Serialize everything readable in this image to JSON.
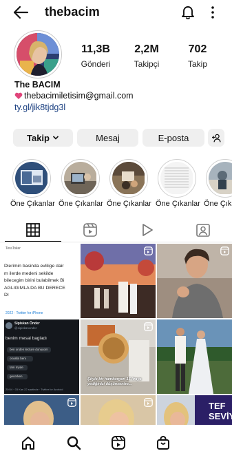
{
  "header": {
    "username": "thebacim"
  },
  "profile": {
    "stats": [
      {
        "value": "11,3B",
        "label": "Gönderi"
      },
      {
        "value": "2,2M",
        "label": "Takipçi"
      },
      {
        "value": "702",
        "label": "Takip"
      }
    ],
    "name": "The BACIM",
    "email": "thebacimiletisim@gmail.com",
    "link": "ty.gl/jik8tjdg3l"
  },
  "actions": {
    "follow": "Takip",
    "message": "Mesaj",
    "email": "E-posta"
  },
  "highlights": [
    {
      "label": "Öne Çıkanlar"
    },
    {
      "label": "Öne Çıkanlar"
    },
    {
      "label": "Öne Çıkanlar"
    },
    {
      "label": "Öne Çıkanlar"
    },
    {
      "label": "Öne Çıka"
    }
  ],
  "posts": {
    "tweet1": {
      "source": "TeraToker",
      "lines": [
        "Dlerimin basinda evlilige dair",
        "m ilerde medeni sekilde",
        "bilecegim birini bulabilmek  Bi",
        "AGLIGIMLA DA BU DERECE",
        "DI"
      ],
      "footer": "2022 · Twitter for iPhone"
    },
    "tweet2": {
      "account": "Sipiskan Önder",
      "handle": "@sipiskanonder",
      "headline": "benim mesai bagladı",
      "chats": [
        "ben onden lecture donuyom",
        "osvalla beni",
        "tam myde",
        "gecerken"
      ],
      "footer": "20:54 · 03 Kas 22 saatinde · Twitter for Android"
    },
    "burger_caption": "Şöyle bir hamburgeri 15 liraya yediğinizi düşünsenize...",
    "promo_text": [
      "TEF",
      "SEVİY"
    ]
  },
  "colors": {
    "link": "#1a3f80",
    "button_bg": "#efefef",
    "heart": "#e0457b"
  }
}
